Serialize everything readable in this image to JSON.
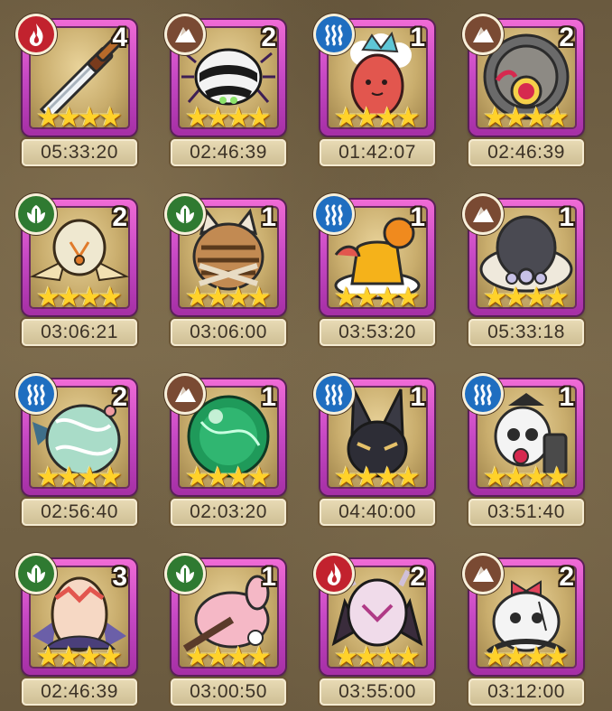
{
  "element_colors": {
    "fire": "#c2222e",
    "earth": "#7a4a33",
    "water": "#1f6ec0",
    "wind": "#2f7a31"
  },
  "pets": [
    {
      "element": "fire",
      "element_icon": "flame-icon",
      "count": "4",
      "stars": 4,
      "time": "05:33:20",
      "art": "dagger"
    },
    {
      "element": "earth",
      "element_icon": "mountain-icon",
      "count": "2",
      "stars": 4,
      "time": "02:46:39",
      "art": "spider"
    },
    {
      "element": "water",
      "element_icon": "wave-icon",
      "count": "1",
      "stars": 4,
      "time": "01:42:07",
      "art": "fish"
    },
    {
      "element": "earth",
      "element_icon": "mountain-icon",
      "count": "2",
      "stars": 4,
      "time": "02:46:39",
      "art": "machine"
    },
    {
      "element": "wind",
      "element_icon": "leaf-icon",
      "count": "2",
      "stars": 4,
      "time": "03:06:21",
      "art": "bird"
    },
    {
      "element": "wind",
      "element_icon": "leaf-icon",
      "count": "1",
      "stars": 4,
      "time": "03:06:00",
      "art": "cat"
    },
    {
      "element": "water",
      "element_icon": "wave-icon",
      "count": "1",
      "stars": 4,
      "time": "03:53:20",
      "art": "pudding"
    },
    {
      "element": "earth",
      "element_icon": "mountain-icon",
      "count": "1",
      "stars": 4,
      "time": "05:33:18",
      "art": "hat"
    },
    {
      "element": "water",
      "element_icon": "wave-icon",
      "count": "2",
      "stars": 4,
      "time": "02:56:40",
      "art": "ghost"
    },
    {
      "element": "earth",
      "element_icon": "mountain-icon",
      "count": "1",
      "stars": 4,
      "time": "02:03:20",
      "art": "orb"
    },
    {
      "element": "water",
      "element_icon": "wave-icon",
      "count": "1",
      "stars": 4,
      "time": "04:40:00",
      "art": "jackal"
    },
    {
      "element": "water",
      "element_icon": "wave-icon",
      "count": "1",
      "stars": 4,
      "time": "03:51:40",
      "art": "skull"
    },
    {
      "element": "wind",
      "element_icon": "leaf-icon",
      "count": "3",
      "stars": 4,
      "time": "02:46:39",
      "art": "egg"
    },
    {
      "element": "wind",
      "element_icon": "leaf-icon",
      "count": "1",
      "stars": 4,
      "time": "03:00:50",
      "art": "bunny"
    },
    {
      "element": "fire",
      "element_icon": "flame-icon",
      "count": "2",
      "stars": 4,
      "time": "03:55:00",
      "art": "demon"
    },
    {
      "element": "earth",
      "element_icon": "mountain-icon",
      "count": "2",
      "stars": 4,
      "time": "03:12:00",
      "art": "doll"
    }
  ],
  "star_glyph": "★"
}
